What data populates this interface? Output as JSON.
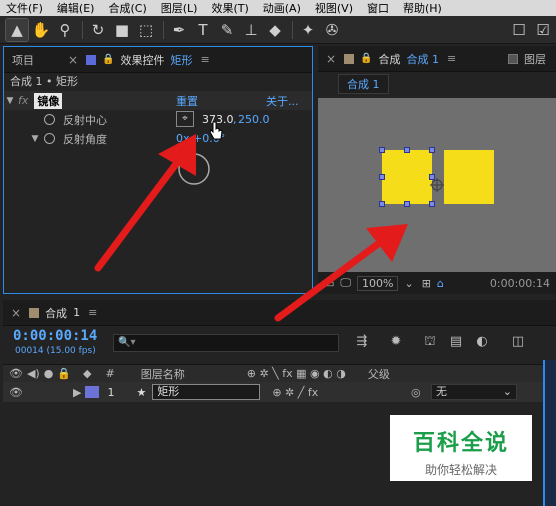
{
  "menubar": [
    "文件(F)",
    "编辑(E)",
    "合成(C)",
    "图层(L)",
    "效果(T)",
    "动画(A)",
    "视图(V)",
    "窗口",
    "帮助(H)"
  ],
  "toolbar": {
    "tools": [
      "selection-tool",
      "hand-tool",
      "zoom-tool",
      "rotate-tool",
      "camera-tool",
      "pan-behind-tool",
      "pen-tool",
      "text-tool",
      "brush-tool",
      "clone-stamp-tool",
      "eraser-tool",
      "roto-brush-tool",
      "puppet-tool"
    ],
    "icons": {
      "selection": "▲",
      "hand": "✋",
      "zoom": "🔍",
      "rotate": "↻",
      "camera": "■",
      "pan": "⬚",
      "pen": "✒",
      "text": "T",
      "brush": "✎",
      "stamp": "⊥",
      "eraser": "◆",
      "roto": "✦",
      "puppet": "✇"
    }
  },
  "effects_panel": {
    "tab_project": "项目",
    "tab_effects": "效果控件",
    "tab_effects_target": "矩形",
    "layer_line": "合成 1 • 矩形",
    "effect": {
      "fx": "fx",
      "name": "镜像",
      "reset": "重置",
      "about": "关于..."
    },
    "props": [
      {
        "label": "反射中心",
        "value_x": "373.0",
        "value_sep": ",",
        "value_y": "250.0"
      },
      {
        "label": "反射角度",
        "value": "0x +0.0°"
      }
    ]
  },
  "comp_panel": {
    "tab_label": "合成",
    "tab_target": "合成 1",
    "tab_layer": "图层",
    "subtab": "合成 1",
    "footer": {
      "zoom": "100%",
      "timecode": "0:00:00:14"
    },
    "colors": {
      "viewer_bg": "#6f6f6f",
      "shape": "#f5dd1a"
    }
  },
  "timeline": {
    "tab_label": "合成",
    "tab_target": "1",
    "timecode": "0:00:00:14",
    "fps": "00014 (15.00 fps)",
    "search_placeholder": "🔍▾",
    "columns": {
      "num": "#",
      "layer_name": "图层名称",
      "parent": "父级"
    },
    "layer": {
      "num": "1",
      "name": "矩形",
      "parent": "无"
    }
  },
  "watermark": {
    "title": "百科全说",
    "subtitle": "助你轻松解决"
  },
  "accent": "#2d8ceb",
  "arrow_color": "#e31b1b"
}
